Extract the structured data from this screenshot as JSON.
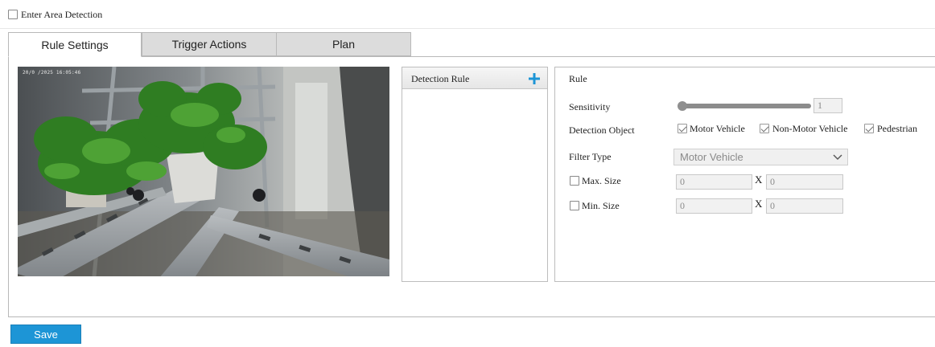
{
  "enable": {
    "label": "Enter Area Detection",
    "checked": false
  },
  "tabs": [
    {
      "label": "Rule Settings",
      "active": true
    },
    {
      "label": "Trigger Actions",
      "active": false
    },
    {
      "label": "Plan",
      "active": false
    }
  ],
  "video": {
    "timestamp": "20/0 /2025 16:05:46"
  },
  "rule_list": {
    "header": "Detection Rule",
    "add_icon": "plus-icon"
  },
  "rule": {
    "title": "Rule",
    "sensitivity": {
      "label": "Sensitivity",
      "value": "1",
      "level": 0.0
    },
    "detection_object": {
      "label": "Detection Object",
      "options": [
        {
          "label": "Motor Vehicle",
          "checked": true
        },
        {
          "label": "Non-Motor Vehicle",
          "checked": true
        },
        {
          "label": "Pedestrian",
          "checked": true
        }
      ]
    },
    "filter_type": {
      "label": "Filter Type",
      "value": "Motor Vehicle"
    },
    "max_size": {
      "label": "Max. Size",
      "checked": false,
      "width": "0",
      "height": "0",
      "separator": "X"
    },
    "min_size": {
      "label": "Min. Size",
      "checked": false,
      "width": "0",
      "height": "0",
      "separator": "X"
    }
  },
  "save_label": "Save",
  "colors": {
    "accent": "#1d95d6",
    "tab_inactive": "#dcdcdc",
    "border": "#b8b8b8"
  }
}
